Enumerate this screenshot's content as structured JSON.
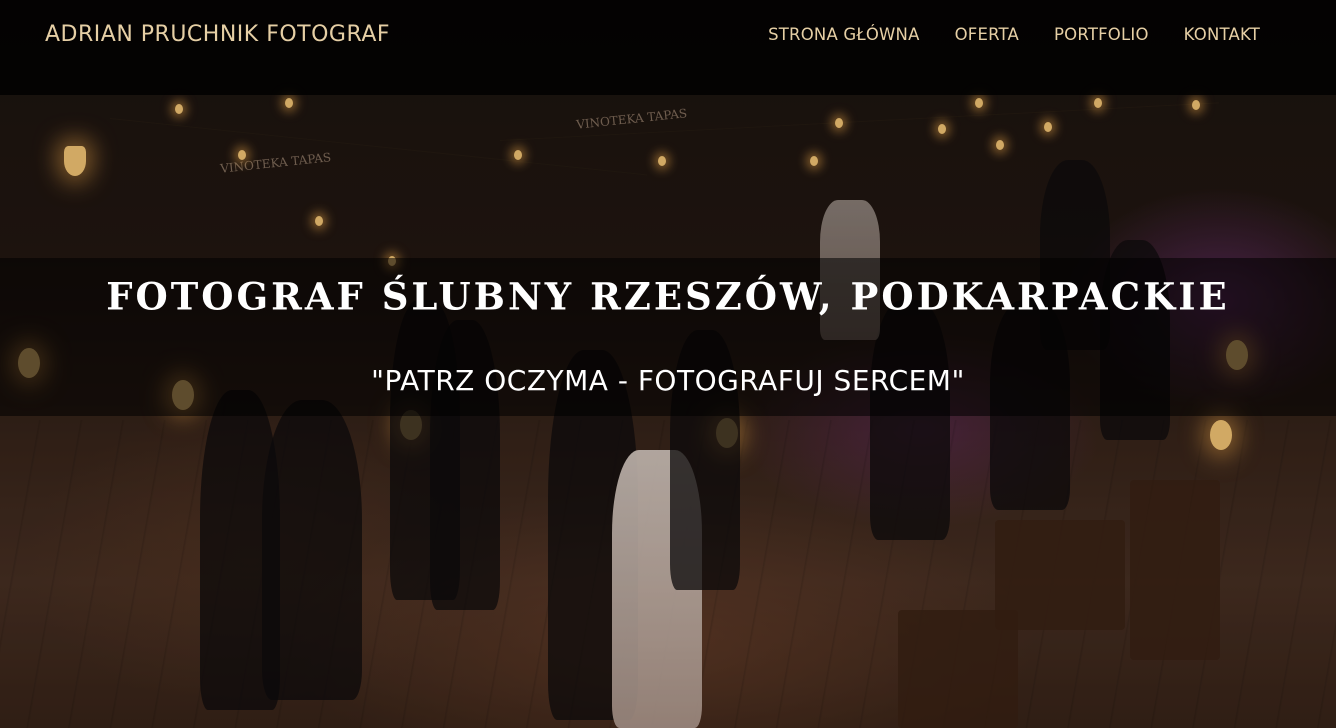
{
  "header": {
    "brand": "ADRIAN PRUCHNIK FOTOGRAF",
    "nav": [
      {
        "label": "STRONA GŁÓWNA"
      },
      {
        "label": "OFERTA"
      },
      {
        "label": "PORTFOLIO"
      },
      {
        "label": "KONTAKT"
      }
    ]
  },
  "hero": {
    "title": "FOTOGRAF ŚLUBNY RZESZÓW, PODKARPACKIE",
    "subtitle": "\"PATRZ OCZYMA - FOTOGRAFUJ SERCEM\"",
    "background_signs": [
      "VINOTEKA TAPAS",
      "VINOTEKA TAPAS"
    ]
  },
  "colors": {
    "header_bg": "#000000",
    "brand_text": "#e6cfa5",
    "nav_text": "#e6cfa5",
    "hero_text": "#ffffff"
  }
}
